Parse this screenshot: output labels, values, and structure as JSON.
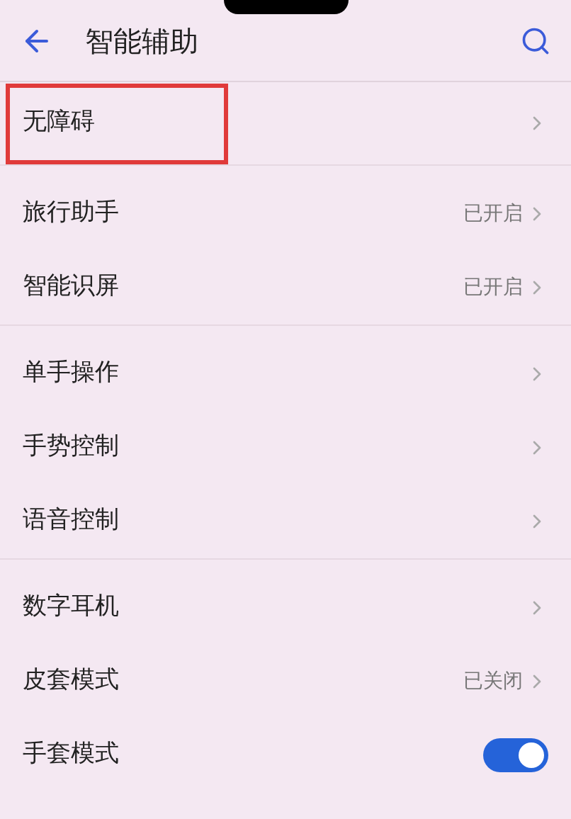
{
  "header": {
    "title": "智能辅助"
  },
  "groups": [
    {
      "items": [
        {
          "kind": "link",
          "label": "无障碍",
          "highlighted": true
        }
      ]
    },
    {
      "items": [
        {
          "kind": "link",
          "label": "旅行助手",
          "value": "已开启",
          "highlighted": false
        },
        {
          "kind": "link",
          "label": "智能识屏",
          "value": "已开启",
          "highlighted": false
        }
      ]
    },
    {
      "items": [
        {
          "kind": "link",
          "label": "单手操作",
          "highlighted": false
        },
        {
          "kind": "link",
          "label": "手势控制",
          "highlighted": false
        },
        {
          "kind": "link",
          "label": "语音控制",
          "highlighted": false
        }
      ]
    },
    {
      "items": [
        {
          "kind": "link",
          "label": "数字耳机",
          "highlighted": false
        },
        {
          "kind": "link",
          "label": "皮套模式",
          "value": "已关闭",
          "highlighted": false
        },
        {
          "kind": "toggle",
          "label": "手套模式",
          "on": true,
          "highlighted": false
        }
      ]
    }
  ]
}
